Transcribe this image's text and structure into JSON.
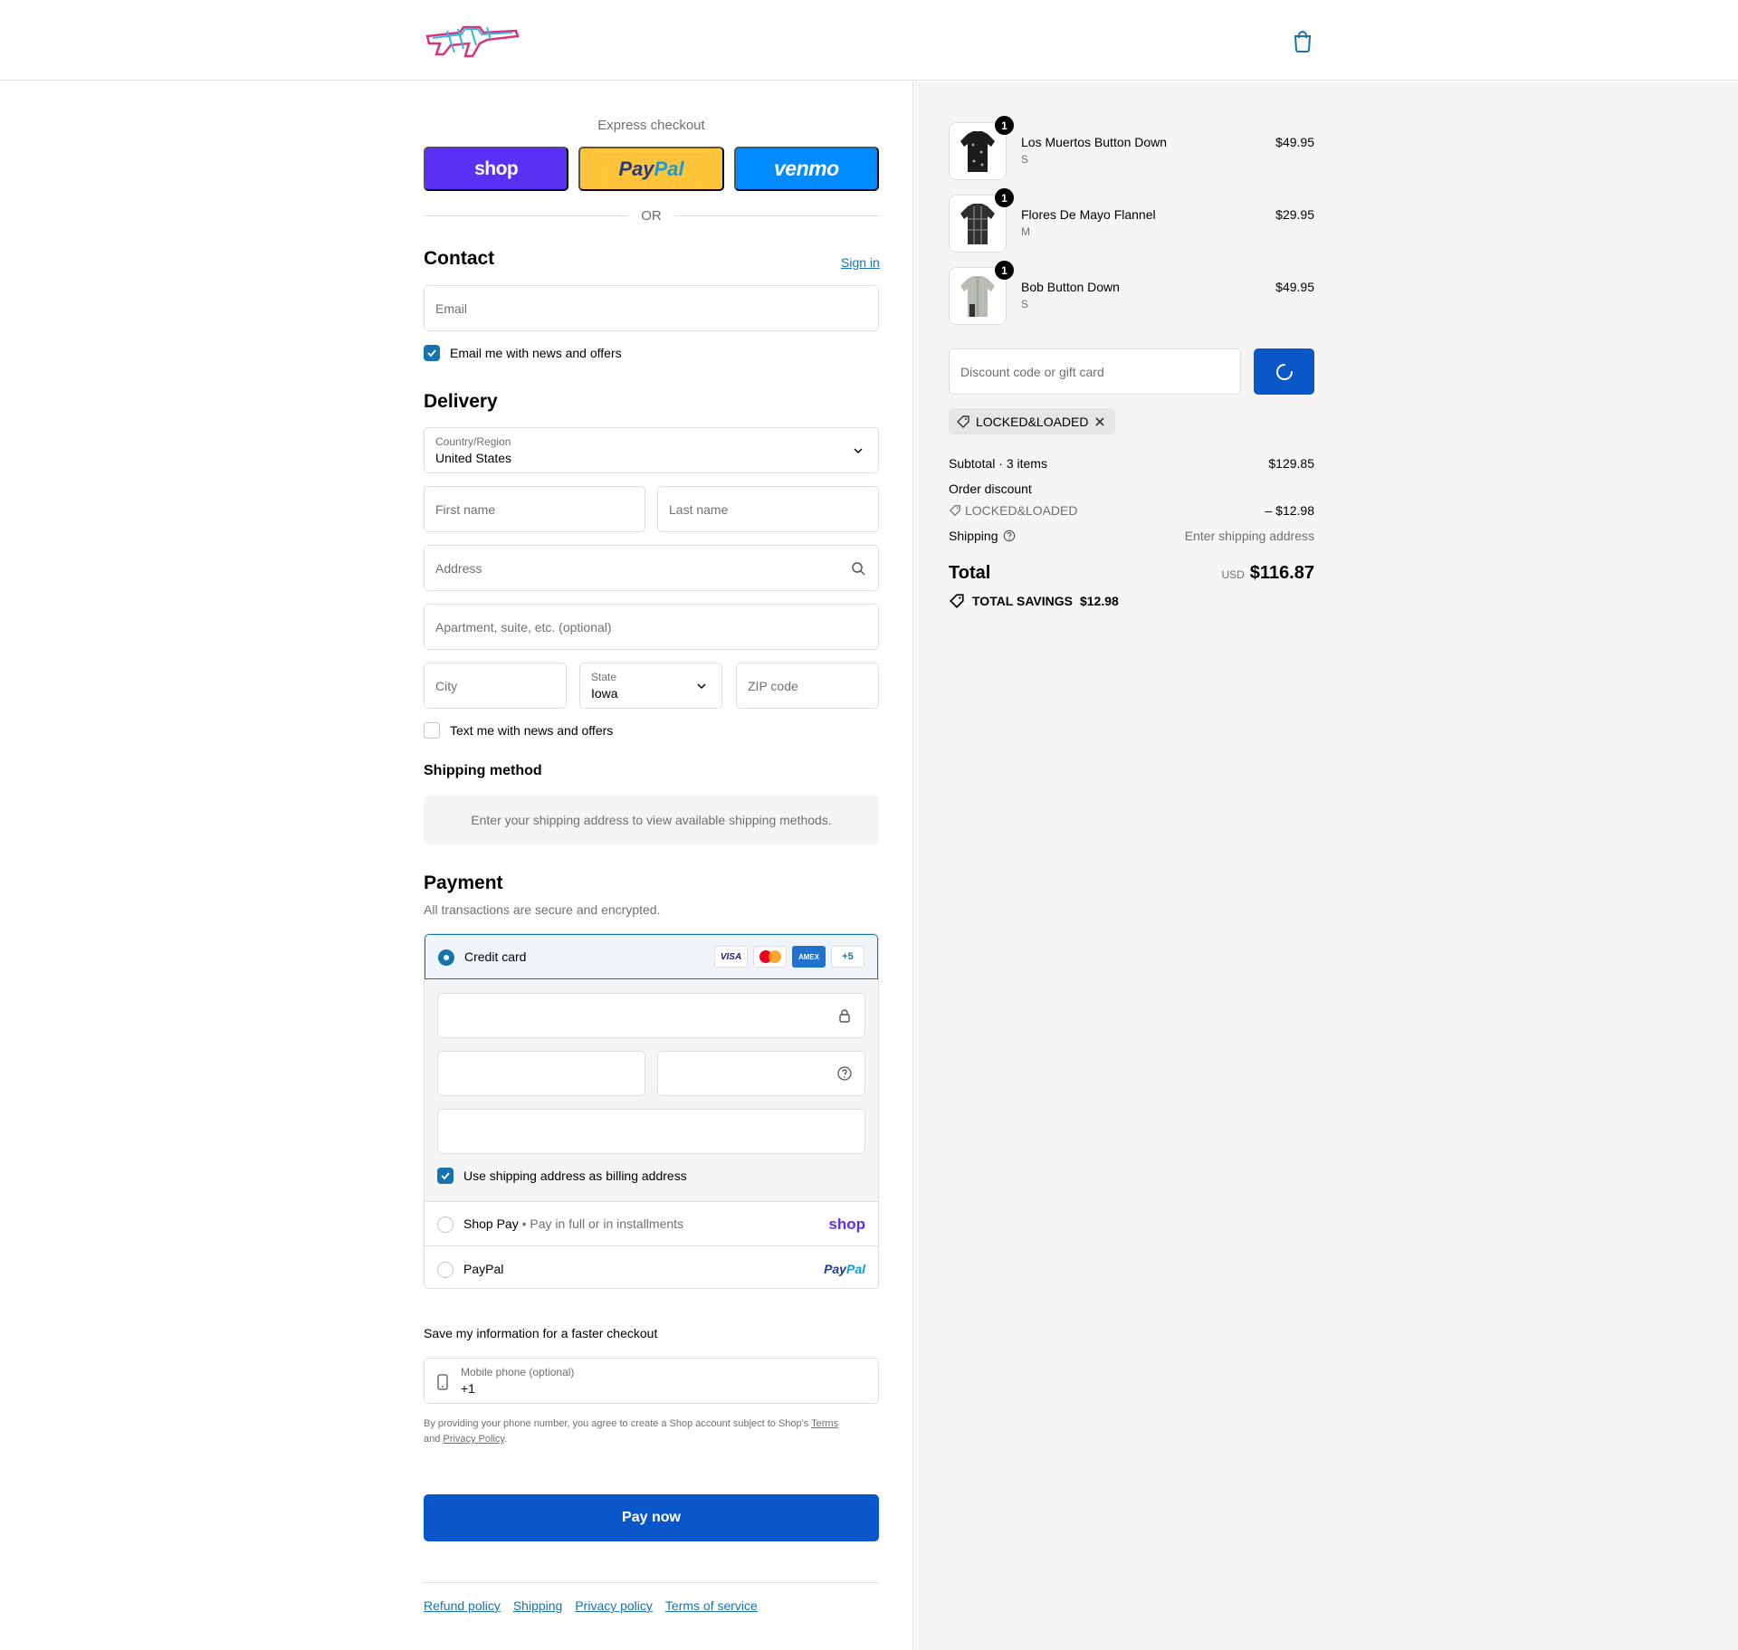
{
  "header": {
    "logo_alt": "Pixel-art rifle logo",
    "cart_icon": "shopping-bag-icon"
  },
  "express": {
    "label": "Express checkout",
    "shop_label": "shop",
    "paypal_label_a": "Pay",
    "paypal_label_b": "Pal",
    "venmo_label": "venmo",
    "or_label": "OR"
  },
  "contact": {
    "heading": "Contact",
    "signin": "Sign in",
    "email_placeholder": "Email",
    "news_label": "Email me with news and offers"
  },
  "delivery": {
    "heading": "Delivery",
    "country_label": "Country/Region",
    "country_value": "United States",
    "first_name_placeholder": "First name",
    "last_name_placeholder": "Last name",
    "address_placeholder": "Address",
    "apartment_placeholder": "Apartment, suite, etc. (optional)",
    "city_placeholder": "City",
    "state_label": "State",
    "state_value": "Iowa",
    "zip_placeholder": "ZIP code",
    "text_label": "Text me with news and offers"
  },
  "shipping_method": {
    "heading": "Shipping method",
    "message": "Enter your shipping address to view available shipping methods."
  },
  "payment": {
    "heading": "Payment",
    "subtitle": "All transactions are secure and encrypted.",
    "credit_card_label": "Credit card",
    "card_visa": "VISA",
    "card_amex": "AMEX",
    "card_more": "+5",
    "billing_label": "Use shipping address as billing address",
    "shop_pay_label": "Shop Pay",
    "shop_pay_sub": "Pay in full or in installments",
    "shop_pay_logo": "shop",
    "paypal_label": "PayPal",
    "paypal_logo_a": "Pay",
    "paypal_logo_b": "Pal"
  },
  "save_info": {
    "label": "Save my information for a faster checkout",
    "phone_label": "Mobile phone (optional)",
    "phone_value": "+1",
    "disclaimer_prefix": "By providing your phone number, you agree to create a Shop account subject to Shop's ",
    "terms": "Terms",
    "and": "and ",
    "privacy": "Privacy Policy",
    "period": "."
  },
  "pay_now": "Pay now",
  "footer_links": [
    "Refund policy",
    "Shipping",
    "Privacy policy",
    "Terms of service"
  ],
  "order": {
    "items": [
      {
        "name": "Los Muertos Button Down",
        "variant": "S",
        "price": "$49.95",
        "qty": "1",
        "color": "#1c1c1c"
      },
      {
        "name": "Flores De Mayo Flannel",
        "variant": "M",
        "price": "$29.95",
        "qty": "1",
        "color": "#2f2f2f"
      },
      {
        "name": "Bob Button Down",
        "variant": "S",
        "price": "$49.95",
        "qty": "1",
        "color": "#b7bcb2"
      }
    ],
    "discount_placeholder": "Discount code or gift card",
    "applied_code": "LOCKED&LOADED",
    "subtotal_label": "Subtotal · 3 items",
    "subtotal_value": "$129.85",
    "order_discount_label": "Order discount",
    "discount_code": "LOCKED&LOADED",
    "discount_value": "– $12.98",
    "shipping_label": "Shipping",
    "shipping_value": "Enter shipping address",
    "total_label": "Total",
    "currency": "USD",
    "total_value": "$116.87",
    "savings_label": "TOTAL SAVINGS",
    "savings_value": "$12.98"
  }
}
